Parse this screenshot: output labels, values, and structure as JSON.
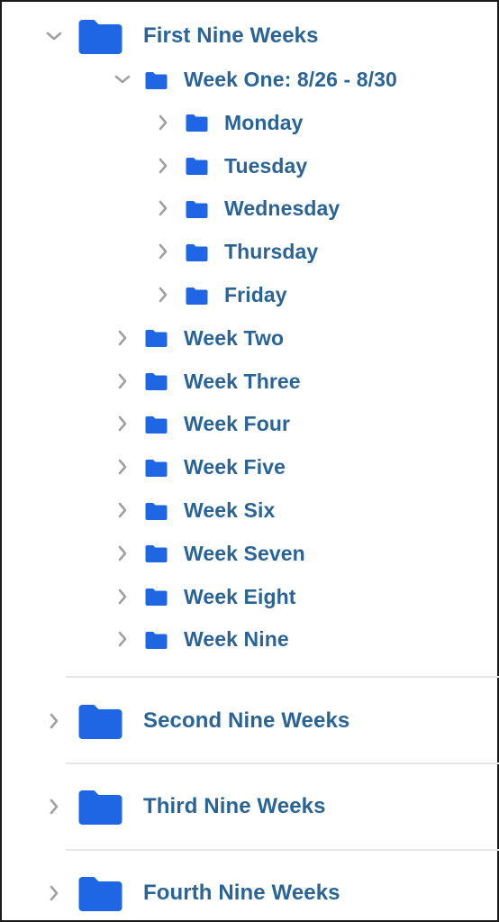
{
  "tree": {
    "folder_color": "#1f66e5",
    "text_color": "#2a6496",
    "chevron_color": "#a0a0a0",
    "quarters": [
      {
        "label": "First Nine Weeks",
        "expanded": true,
        "weeks": [
          {
            "label": "Week One: 8/26 - 8/30",
            "expanded": true,
            "days": [
              {
                "label": "Monday",
                "expanded": false
              },
              {
                "label": "Tuesday",
                "expanded": false
              },
              {
                "label": "Wednesday",
                "expanded": false
              },
              {
                "label": "Thursday",
                "expanded": false
              },
              {
                "label": "Friday",
                "expanded": false
              }
            ]
          },
          {
            "label": "Week Two",
            "expanded": false
          },
          {
            "label": "Week Three",
            "expanded": false
          },
          {
            "label": "Week Four",
            "expanded": false
          },
          {
            "label": "Week Five",
            "expanded": false
          },
          {
            "label": "Week Six",
            "expanded": false
          },
          {
            "label": "Week Seven",
            "expanded": false
          },
          {
            "label": "Week Eight",
            "expanded": false
          },
          {
            "label": "Week Nine",
            "expanded": false
          }
        ]
      },
      {
        "label": "Second Nine Weeks",
        "expanded": false
      },
      {
        "label": "Third Nine Weeks",
        "expanded": false
      },
      {
        "label": "Fourth Nine Weeks",
        "expanded": false
      }
    ],
    "icons": {
      "expanded": "chevron-down-icon",
      "collapsed": "chevron-right-icon",
      "folder": "folder-icon"
    }
  }
}
